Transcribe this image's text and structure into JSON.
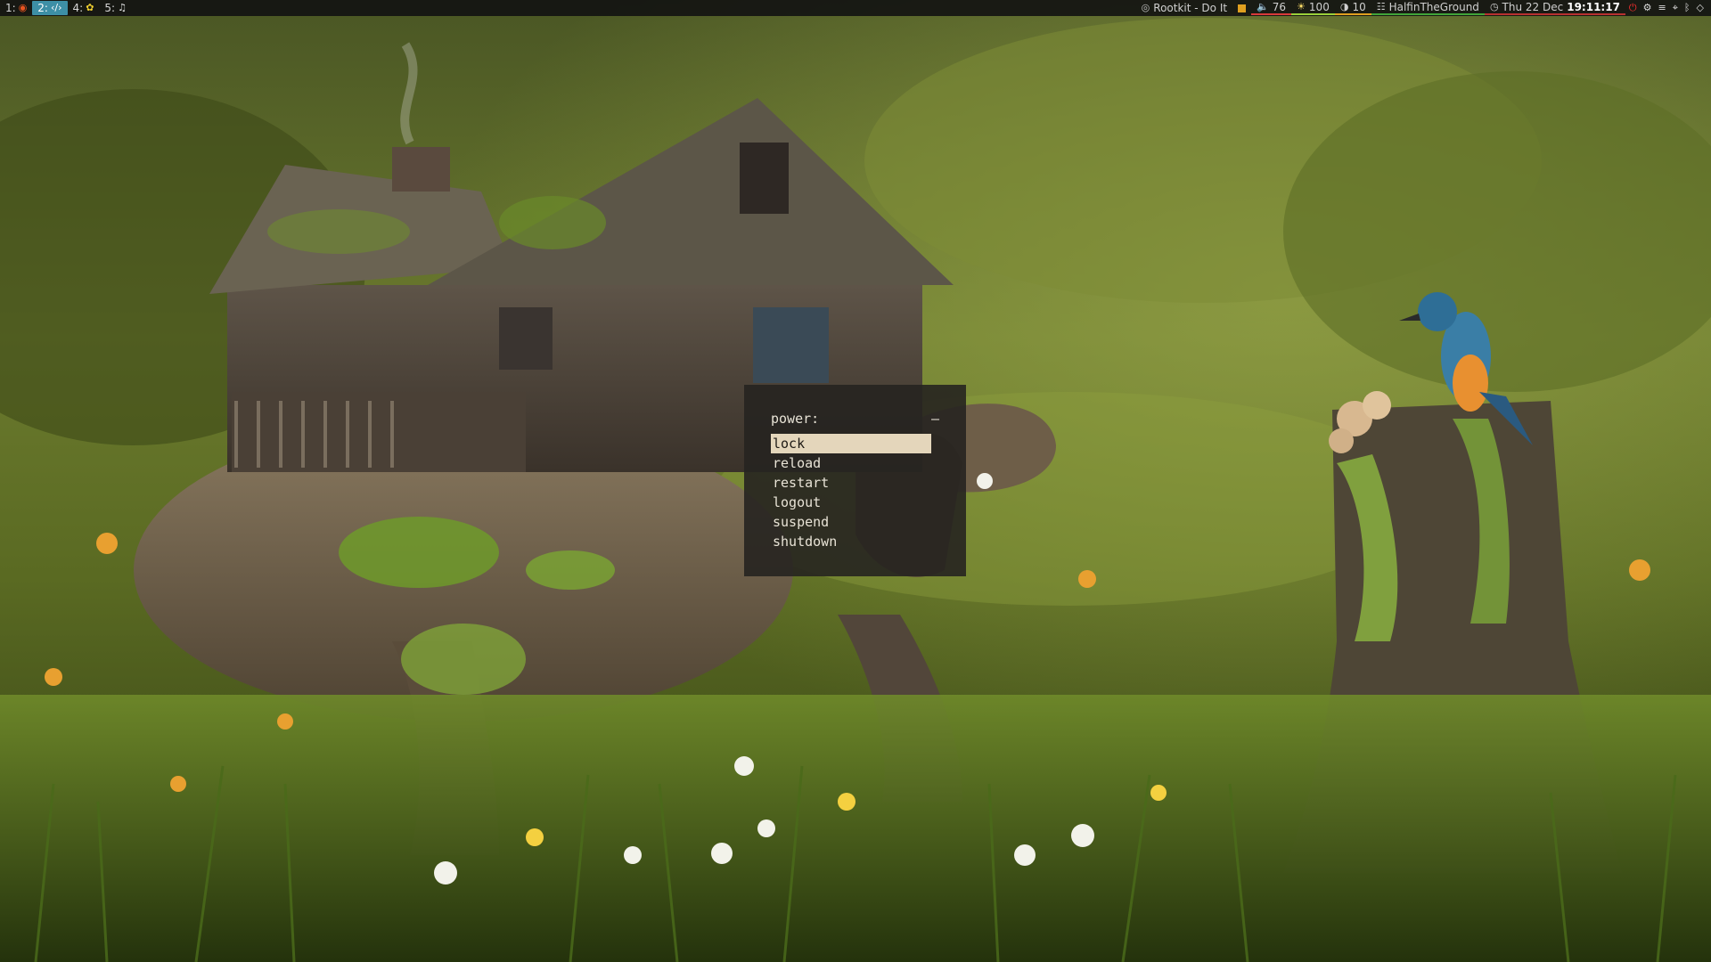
{
  "workspaces": [
    {
      "num": "1:",
      "icon": "ubuntu-icon",
      "glyph": "◉",
      "active": false
    },
    {
      "num": "2:",
      "icon": "code-icon",
      "glyph": "‹/›",
      "active": true
    },
    {
      "num": "4:",
      "icon": "flower-icon",
      "glyph": "✿",
      "active": false
    },
    {
      "num": "5:",
      "icon": "music-icon",
      "glyph": "♫",
      "active": false
    }
  ],
  "statusbar": {
    "media": {
      "icon": "media-icon",
      "glyph": "◎",
      "text": "Rootkit - Do It"
    },
    "indicator": {
      "color": "#e0a020"
    },
    "volume": {
      "icon": "speaker-icon",
      "glyph": "🔈",
      "value": "76",
      "color": "#d83a3a"
    },
    "brightness": {
      "icon": "brightness-icon",
      "glyph": "☀",
      "value": "100"
    },
    "caffeine": {
      "icon": "contrast-icon",
      "glyph": "◑",
      "value": "10"
    },
    "wifi": {
      "icon": "wifi-icon",
      "glyph": "☷",
      "ssid": "HalfinTheGround"
    },
    "clock": {
      "icon": "clock-icon",
      "glyph": "◷",
      "date": "Thu 22 Dec",
      "time": "19:11:17"
    },
    "tray": [
      {
        "name": "power-icon",
        "glyph": "⏻"
      },
      {
        "name": "settings-icon",
        "glyph": "⚙"
      },
      {
        "name": "network-icon",
        "glyph": "≡"
      },
      {
        "name": "location-icon",
        "glyph": "⌖"
      },
      {
        "name": "bluetooth-icon",
        "glyph": "ᛒ"
      },
      {
        "name": "shield-icon",
        "glyph": "◇"
      }
    ]
  },
  "menu": {
    "prompt": "power:",
    "cursor": "–",
    "items": [
      "lock",
      "reload",
      "restart",
      "logout",
      "suspend",
      "shutdown"
    ],
    "selected_index": 0
  }
}
